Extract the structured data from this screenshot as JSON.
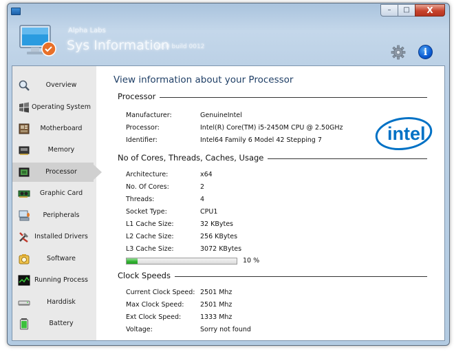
{
  "window": {
    "min_label": "–",
    "max_label": "□",
    "close_label": "X"
  },
  "header": {
    "brand": "Alpha Labs",
    "title": "Sys Information",
    "version": "v1.0 build 0012"
  },
  "sidebar": {
    "items": [
      {
        "label": "Overview",
        "icon": "magnifier-icon"
      },
      {
        "label": "Operating System",
        "icon": "windows-flag-icon"
      },
      {
        "label": "Motherboard",
        "icon": "motherboard-icon"
      },
      {
        "label": "Memory",
        "icon": "memory-icon"
      },
      {
        "label": "Processor",
        "icon": "processor-icon"
      },
      {
        "label": "Graphic Card",
        "icon": "graphic-card-icon"
      },
      {
        "label": "Peripherals",
        "icon": "peripherals-icon"
      },
      {
        "label": "Installed Drivers",
        "icon": "drivers-icon"
      },
      {
        "label": "Software",
        "icon": "software-icon"
      },
      {
        "label": "Running Process",
        "icon": "process-icon"
      },
      {
        "label": "Harddisk",
        "icon": "harddisk-icon"
      },
      {
        "label": "Battery",
        "icon": "battery-icon"
      }
    ],
    "active": "Processor"
  },
  "main": {
    "title": "View information about your Processor",
    "sections": [
      {
        "title": "Processor",
        "rows": [
          {
            "key": "Manufacturer:",
            "value": "GenuineIntel"
          },
          {
            "key": "Processor:",
            "value": "Intel(R) Core(TM) i5-2450M CPU @ 2.50GHz"
          },
          {
            "key": "Identifier:",
            "value": "Intel64 Family 6 Model 42 Stepping 7"
          }
        ]
      },
      {
        "title": "No of Cores, Threads, Caches, Usage",
        "rows": [
          {
            "key": "Architecture:",
            "value": "x64"
          },
          {
            "key": "No. Of Cores:",
            "value": "2"
          },
          {
            "key": "Threads:",
            "value": "4"
          },
          {
            "key": "Socket Type:",
            "value": "CPU1"
          },
          {
            "key": "L1 Cache Size:",
            "value": "32 KBytes"
          },
          {
            "key": "L2 Cache Size:",
            "value": "256 KBytes"
          },
          {
            "key": "L3 Cache Size:",
            "value": "3072 KBytes"
          }
        ]
      },
      {
        "title": "Clock Speeds",
        "rows": [
          {
            "key": "Current Clock Speed:",
            "value": "2501 Mhz"
          },
          {
            "key": "Max Clock Speed:",
            "value": "2501 Mhz"
          },
          {
            "key": "Ext Clock Speed:",
            "value": "1333 Mhz"
          },
          {
            "key": "Voltage:",
            "value": "Sorry not found"
          }
        ]
      }
    ],
    "usage": {
      "percent": 10,
      "label": "10 %"
    },
    "brand_logo_text": "intel"
  },
  "colors": {
    "accent": "#1f3f66",
    "progress": "#2fb12f",
    "intel_blue": "#0071c5"
  }
}
